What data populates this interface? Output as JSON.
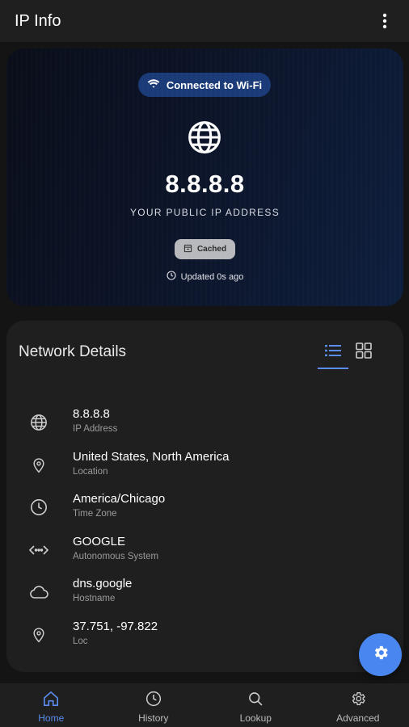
{
  "app_bar": {
    "title": "IP Info",
    "menu_icon": "more-vert-icon"
  },
  "hero": {
    "connection_status": "Connected to Wi-Fi",
    "ip": "8.8.8.8",
    "caption": "YOUR PUBLIC IP ADDRESS",
    "cache_badge": "Cached",
    "updated": "Updated 0s ago",
    "pill_color": "#1a3a78"
  },
  "details": {
    "title": "Network Details",
    "views": [
      {
        "name": "list",
        "icon": "list-icon",
        "active": true
      },
      {
        "name": "grid",
        "icon": "grid-icon",
        "active": false
      }
    ],
    "rows": [
      {
        "value": "8.8.8.8",
        "label": "IP Address",
        "icon": "globe-icon"
      },
      {
        "value": "United States, North America",
        "label": "Location",
        "icon": "location-pin-icon"
      },
      {
        "value": "America/Chicago",
        "label": "Time Zone",
        "icon": "clock-icon"
      },
      {
        "value": "GOOGLE",
        "label": "Autonomous System",
        "icon": "code-arrows-icon"
      },
      {
        "value": "dns.google",
        "label": "Hostname",
        "icon": "cloud-icon"
      },
      {
        "value": "37.751, -97.822",
        "label": "Loc",
        "icon": "location-pin-icon"
      }
    ]
  },
  "fab": {
    "icon": "settings-gear-icon",
    "color": "#4a86f0"
  },
  "bottom_nav": [
    {
      "label": "Home",
      "icon": "home-icon",
      "active": true
    },
    {
      "label": "History",
      "icon": "history-icon",
      "active": false
    },
    {
      "label": "Lookup",
      "icon": "search-icon",
      "active": false
    },
    {
      "label": "Advanced",
      "icon": "gear-icon",
      "active": false
    }
  ],
  "accent_color": "#5b8def"
}
